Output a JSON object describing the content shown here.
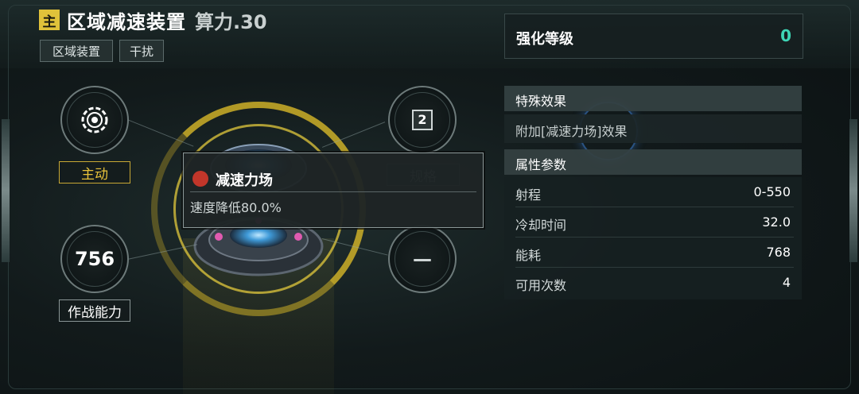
{
  "item": {
    "badge": "主",
    "name": "区域减速装置",
    "compute": "算力.30",
    "tags": [
      "区域装置",
      "干扰"
    ]
  },
  "enhance": {
    "label": "强化等级",
    "value": "0"
  },
  "special": {
    "heading": "特殊效果",
    "effect": "附加[减速力场]效果"
  },
  "attributes": {
    "heading": "属性参数",
    "rows": [
      {
        "key": "射程",
        "value": "0-550"
      },
      {
        "key": "冷却时间",
        "value": "32.0"
      },
      {
        "key": "能耗",
        "value": "768"
      },
      {
        "key": "可用次数",
        "value": "4"
      }
    ]
  },
  "left_nodes": {
    "mode_label": "主动",
    "power_value": "756",
    "power_label": "作战能力"
  },
  "right_nodes": {
    "spec_value": "2",
    "spec_label": "规格",
    "empty_value": "—"
  },
  "tooltip": {
    "title": "减速力场",
    "description": "速度降低80.0%"
  },
  "colors": {
    "accent_yellow": "#e0c23a",
    "teal_value": "#3ed6b5",
    "tooltip_icon": "#c2362a"
  },
  "icons": {
    "mode": "target-reticle-icon",
    "tooltip": "slow-field-icon"
  }
}
